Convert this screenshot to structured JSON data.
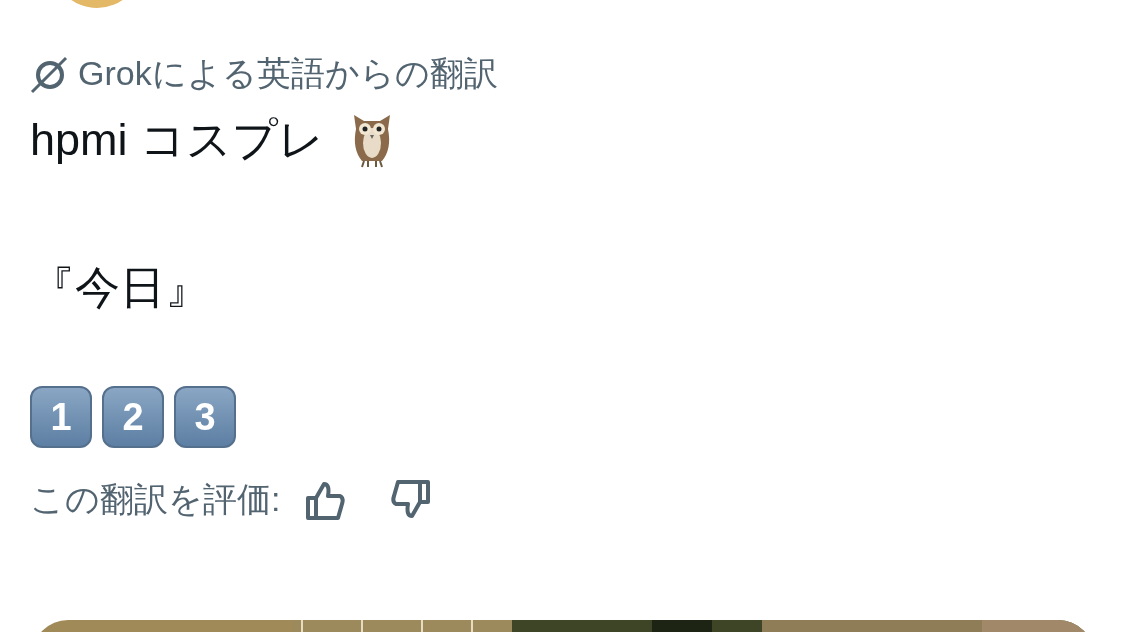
{
  "translation_label": "Grokによる英語からの翻訳",
  "title": "hpmi コスプレ",
  "line": "『今日』",
  "keycaps": [
    "1",
    "2",
    "3"
  ],
  "rating": {
    "label": "この翻訳を評価:"
  }
}
